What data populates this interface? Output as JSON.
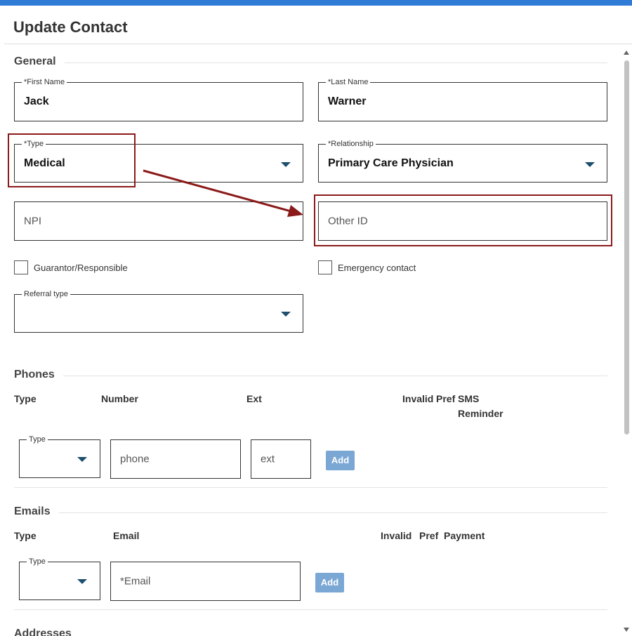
{
  "dialog": {
    "title": "Update Contact"
  },
  "general": {
    "heading": "General",
    "first_name": {
      "label": "*First Name",
      "value": "Jack"
    },
    "last_name": {
      "label": "*Last Name",
      "value": "Warner"
    },
    "type": {
      "label": "*Type",
      "value": "Medical"
    },
    "relationship": {
      "label": "*Relationship",
      "value": "Primary Care Physician"
    },
    "npi": {
      "placeholder": "NPI"
    },
    "other_id": {
      "placeholder": "Other ID"
    },
    "guarantor": {
      "label": "Guarantor/Responsible",
      "checked": false
    },
    "emergency": {
      "label": "Emergency contact",
      "checked": false
    },
    "referral_type": {
      "label": "Referral type",
      "value": ""
    }
  },
  "phones": {
    "heading": "Phones",
    "columns": {
      "type": "Type",
      "number": "Number",
      "ext": "Ext",
      "invalid": "Invalid",
      "pref": "Pref",
      "sms": "SMS",
      "reminder": "Reminder"
    },
    "type_label": "Type",
    "phone_placeholder": "phone",
    "ext_placeholder": "ext",
    "add_label": "Add"
  },
  "emails": {
    "heading": "Emails",
    "columns": {
      "type": "Type",
      "email": "Email",
      "invalid": "Invalid",
      "pref": "Pref",
      "payment": "Payment"
    },
    "type_label": "Type",
    "email_placeholder": "*Email",
    "add_label": "Add"
  },
  "addresses": {
    "heading": "Addresses"
  },
  "colors": {
    "accent": "#2f7bd6",
    "annotation": "#8b1a1a",
    "button": "#7ba7d4",
    "caret": "#1f4f6e"
  }
}
